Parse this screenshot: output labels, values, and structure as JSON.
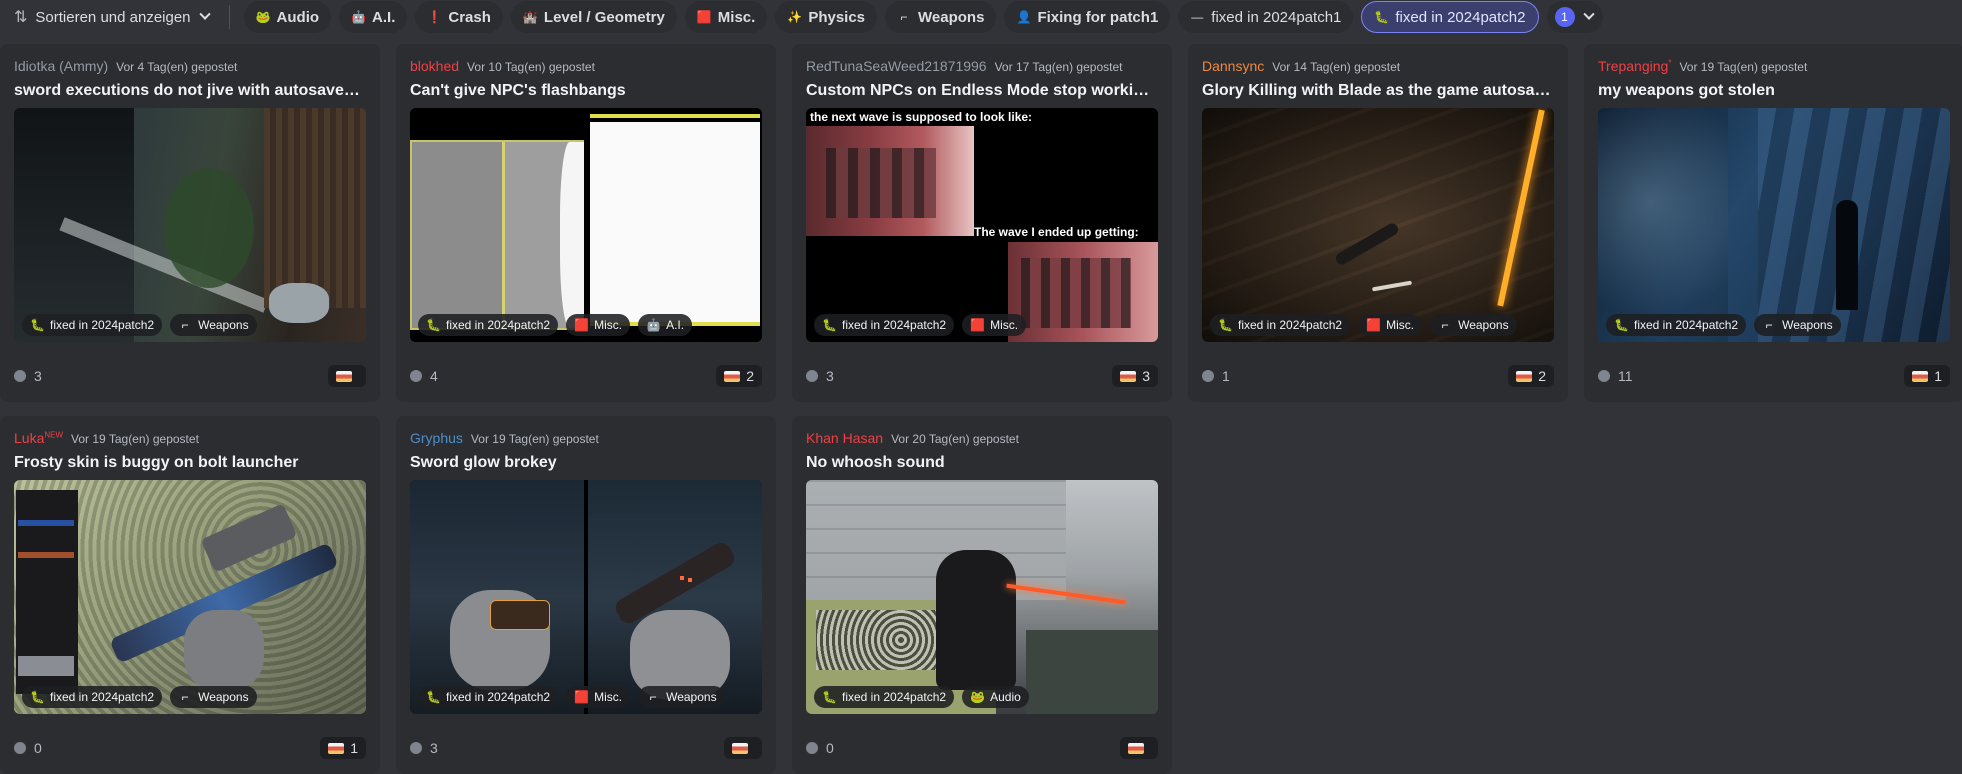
{
  "toolbar": {
    "sort_label": "Sortieren und anzeigen",
    "filters": [
      {
        "label": "Audio",
        "icon": "frog-icon",
        "glyph": "🐸"
      },
      {
        "label": "A.I.",
        "icon": "robot-icon",
        "glyph": "🤖"
      },
      {
        "label": "Crash",
        "icon": "exclamation-icon",
        "glyph": "❗"
      },
      {
        "label": "Level / Geometry",
        "icon": "building-icon",
        "glyph": "🏰"
      },
      {
        "label": "Misc.",
        "icon": "misc-icon",
        "glyph": "🟥"
      },
      {
        "label": "Physics",
        "icon": "physics-icon",
        "glyph": "✨"
      },
      {
        "label": "Weapons",
        "icon": "weapon-icon",
        "glyph": "⌐"
      },
      {
        "label": "Fixing for patch1",
        "icon": "person-icon",
        "glyph": "👤"
      },
      {
        "label": "fixed in 2024patch1",
        "icon": "dash-icon",
        "glyph": "—"
      },
      {
        "label": "fixed in 2024patch2",
        "icon": "creature-icon",
        "glyph": "🐛"
      }
    ],
    "selected_count": "1"
  },
  "colors": {
    "background": "#313338",
    "card": "#2b2d31",
    "accent": "#5865f2",
    "author_red": "#f23f43",
    "author_orange": "#f0883e",
    "author_blue": "#4d8ec9",
    "author_gray": "#949ba4"
  },
  "posts": [
    {
      "author": "Idiotka (Ammy)",
      "author_sup": "",
      "posted": "Vor 4 Tag(en) gepostet",
      "title": "sword executions do not jive with autosaves/ch...",
      "tags": [
        "fixed in 2024patch2",
        "Weapons"
      ],
      "messages": "3",
      "reactions": ""
    },
    {
      "author": "blokhed",
      "author_sup": "",
      "posted": "Vor 10 Tag(en) gepostet",
      "title": "Can't give NPC's flashbangs",
      "tags": [
        "fixed in 2024patch2",
        "Misc.",
        "A.I."
      ],
      "messages": "4",
      "reactions": "2"
    },
    {
      "author": "RedTunaSeaWeed21871996",
      "author_sup": "",
      "posted": "Vor 17 Tag(en) gepostet",
      "title": "Custom NPCs on Endless Mode stop working af...",
      "tags": [
        "fixed in 2024patch2",
        "Misc."
      ],
      "image_text_top": "the next wave is supposed to look like:",
      "image_text_bottom": "The wave I ended up getting:",
      "messages": "3",
      "reactions": "3"
    },
    {
      "author": "Dannsync",
      "author_sup": "",
      "posted": "Vor 14 Tag(en) gepostet",
      "title": "Glory Killing with Blade as the game autosaves ...",
      "tags": [
        "fixed in 2024patch2",
        "Misc.",
        "Weapons"
      ],
      "messages": "1",
      "reactions": "2"
    },
    {
      "author": "Trepanging",
      "author_sup": "*",
      "posted": "Vor 19 Tag(en) gepostet",
      "title": "my weapons got stolen",
      "tags": [
        "fixed in 2024patch2",
        "Weapons"
      ],
      "messages": "11",
      "reactions": "1"
    },
    {
      "author": "Luka",
      "author_sup": "NEW",
      "posted": "Vor 19 Tag(en) gepostet",
      "title": "Frosty skin is buggy on bolt launcher",
      "tags": [
        "fixed in 2024patch2",
        "Weapons"
      ],
      "messages": "0",
      "reactions": "1"
    },
    {
      "author": "Gryphus",
      "author_sup": "",
      "posted": "Vor 19 Tag(en) gepostet",
      "title": "Sword glow brokey",
      "tags": [
        "fixed in 2024patch2",
        "Misc.",
        "Weapons"
      ],
      "messages": "3",
      "reactions": ""
    },
    {
      "author": "Khan Hasan",
      "author_sup": "",
      "posted": "Vor 20 Tag(en) gepostet",
      "title": "No whoosh sound",
      "tags": [
        "fixed in 2024patch2",
        "Audio"
      ],
      "messages": "0",
      "reactions": ""
    }
  ]
}
